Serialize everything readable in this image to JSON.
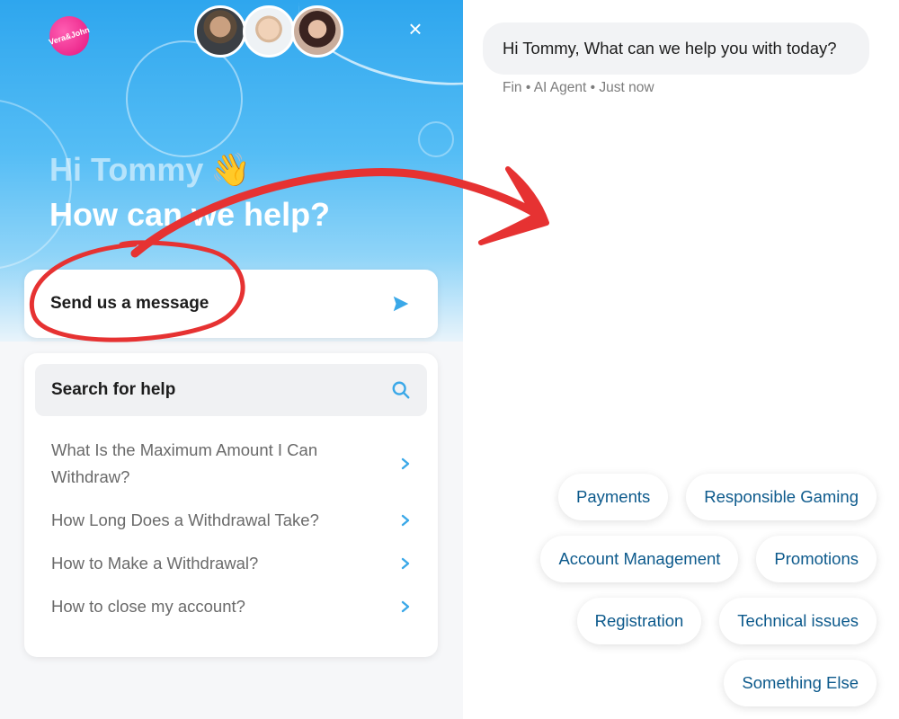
{
  "app": {
    "brand_logo_text": "Vera&John",
    "close_label": "×"
  },
  "hero": {
    "greeting": "Hi Tommy",
    "wave_emoji": "👋",
    "subtitle": "How can we help?"
  },
  "send_message": {
    "label": "Send us a message",
    "icon": "send-arrow-icon"
  },
  "help": {
    "search_label": "Search for help",
    "search_icon": "search-icon",
    "articles": [
      {
        "title": "What Is the Maximum Amount I Can Withdraw?"
      },
      {
        "title": "How Long Does a Withdrawal Take?"
      },
      {
        "title": "How to Make a Withdrawal?"
      },
      {
        "title": "How to close my account?"
      }
    ]
  },
  "chat": {
    "message": "Hi Tommy, What can we help you with today?",
    "meta": "Fin • AI Agent • Just now"
  },
  "quick_replies": [
    [
      "Payments",
      "Responsible Gaming"
    ],
    [
      "Account Management",
      "Promotions"
    ],
    [
      "Registration",
      "Technical issues"
    ],
    [
      "Something Else"
    ]
  ],
  "colors": {
    "hero_blue": "#2ea6ee",
    "accent_blue": "#3aa8e8",
    "chip_text": "#0d5a8c",
    "annotation_red": "#e63232",
    "logo_pink": "#e5147e"
  }
}
